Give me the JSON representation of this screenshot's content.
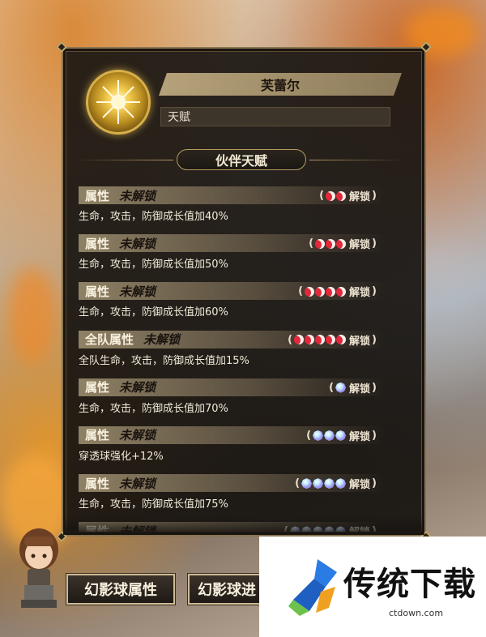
{
  "character": {
    "name": "芙蕾尔",
    "subtitle": "天赋"
  },
  "section_title": "伙伴天赋",
  "talents": [
    {
      "name": "属性",
      "status": "未解锁",
      "req_type": "crescent",
      "req_count": 2,
      "unlock_word": "解锁",
      "desc": "生命，攻击，防御成长值加40%"
    },
    {
      "name": "属性",
      "status": "未解锁",
      "req_type": "crescent",
      "req_count": 3,
      "unlock_word": "解锁",
      "desc": "生命，攻击，防御成长值加50%"
    },
    {
      "name": "属性",
      "status": "未解锁",
      "req_type": "crescent",
      "req_count": 4,
      "unlock_word": "解锁",
      "desc": "生命，攻击，防御成长值加60%"
    },
    {
      "name": "全队属性",
      "status": "未解锁",
      "req_type": "crescent",
      "req_count": 5,
      "unlock_word": "解锁",
      "desc": "全队生命，攻击，防御成长值加15%"
    },
    {
      "name": "属性",
      "status": "未解锁",
      "req_type": "gem",
      "req_count": 1,
      "unlock_word": "解锁",
      "desc": "生命，攻击，防御成长值加70%"
    },
    {
      "name": "属性",
      "status": "未解锁",
      "req_type": "gem",
      "req_count": 3,
      "unlock_word": "解锁",
      "desc": "穿透球强化+12%"
    },
    {
      "name": "属性",
      "status": "未解锁",
      "req_type": "gem",
      "req_count": 4,
      "unlock_word": "解锁",
      "desc": "生命，攻击，防御成长值加75%"
    },
    {
      "name": "属性",
      "status": "未解锁",
      "req_type": "gem",
      "req_count": 5,
      "unlock_word": "解锁",
      "desc": ""
    }
  ],
  "buttons": {
    "phantom_ball_attr": "幻影球属性",
    "phantom_ball_partial": "幻影球进"
  },
  "watermark": {
    "title": "传统下载",
    "url": "ctdown.com"
  },
  "colors": {
    "crescent": "#e2283a",
    "accent_gold": "#c7a96a",
    "panel_bg": "#1c1814"
  }
}
